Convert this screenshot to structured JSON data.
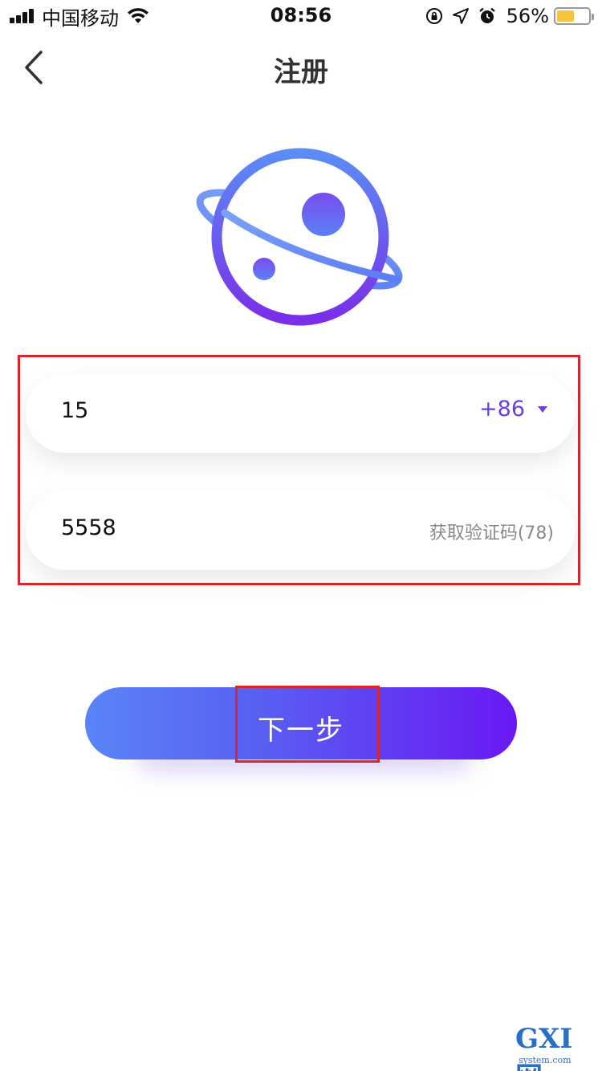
{
  "status_bar": {
    "carrier": "中国移动",
    "time": "08:56",
    "battery_percent": "56%",
    "battery_level": 0.56,
    "icons": [
      "signal-icon",
      "wifi-icon",
      "rotation-lock-icon",
      "location-icon",
      "alarm-icon",
      "battery-icon"
    ]
  },
  "nav": {
    "title": "注册",
    "back_icon": "chevron-left-icon"
  },
  "logo": {
    "icon": "planet-icon",
    "colors": {
      "start": "#5b8cf6",
      "end": "#7a2ee8"
    }
  },
  "form": {
    "phone_value": "15",
    "country_code": "+86",
    "country_dropdown_icon": "caret-down-icon",
    "code_value": "5558",
    "get_code_label": "获取验证码(78)"
  },
  "next_button": {
    "label": "下一步",
    "gradient": {
      "start": "#5a84f7",
      "end": "#6a18f3"
    }
  },
  "highlight_color": "#d8262e",
  "watermark": {
    "main": "GXI网",
    "sub": "system.com"
  }
}
